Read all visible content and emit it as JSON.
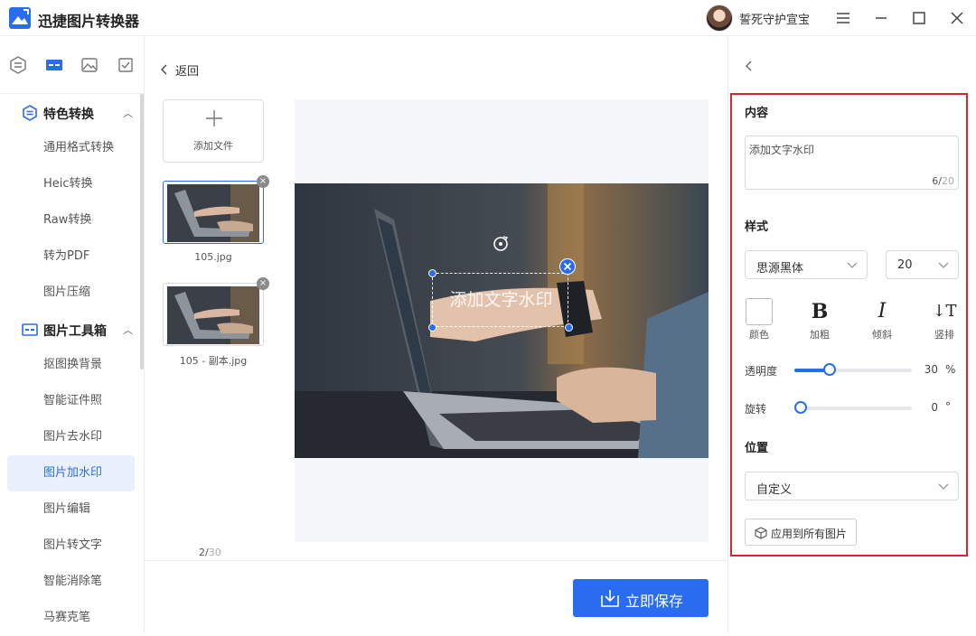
{
  "app": {
    "title": "迅捷图片转换器"
  },
  "user": {
    "name": "誓死守护宣宝"
  },
  "sidebar": {
    "groups": [
      {
        "label": "特色转换",
        "items": [
          "通用格式转换",
          "Heic转换",
          "Raw转换",
          "转为PDF",
          "图片压缩"
        ]
      },
      {
        "label": "图片工具箱",
        "items": [
          "抠图换背景",
          "智能证件照",
          "图片去水印",
          "图片加水印",
          "图片编辑",
          "图片转文字",
          "智能消除笔",
          "马赛克笔"
        ]
      }
    ],
    "active_item": "图片加水印"
  },
  "middle": {
    "back_label": "返回",
    "add_file_label": "添加文件",
    "files": [
      {
        "name": "105.jpg",
        "close": "×"
      },
      {
        "name": "105 - 副本.jpg",
        "close": "×"
      }
    ],
    "counter": {
      "current": "2/",
      "max": "30"
    },
    "watermark_text": "添加文字水印",
    "save_label": "立即保存"
  },
  "panel": {
    "content_title": "内容",
    "content_value": "添加文字水印",
    "content_count": "6/",
    "content_max": "20",
    "style_title": "样式",
    "font_family": "思源黑体",
    "font_size": "20",
    "format": {
      "color_label": "颜色",
      "bold_glyph": "B",
      "bold_label": "加粗",
      "italic_glyph": "I",
      "italic_label": "倾斜",
      "vertical_glyph": "↓T",
      "vertical_label": "竖排"
    },
    "opacity_label": "透明度",
    "opacity_value": "30",
    "opacity_unit": "%",
    "opacity_fraction": 0.3,
    "rotate_label": "旋转",
    "rotate_value": "0",
    "rotate_unit": "°",
    "rotate_fraction": 0.0,
    "position_title": "位置",
    "position_value": "自定义",
    "apply_all_label": "应用到所有图片"
  },
  "colors": {
    "accent": "#2a6cf0",
    "highlight_frame": "#d9262c"
  }
}
